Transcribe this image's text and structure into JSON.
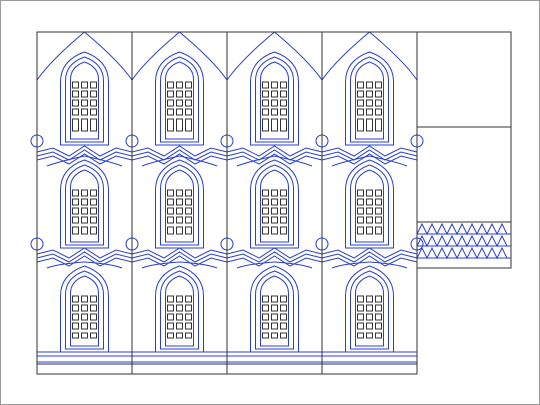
{
  "drawing": {
    "columns": 4,
    "rows": 3,
    "side_panel_sections": 3,
    "colors": {
      "frame_line": "#333333",
      "ornament_line": "#2a3fd0",
      "background": "#ffffff",
      "outer_border": "#9a9a9a"
    }
  }
}
